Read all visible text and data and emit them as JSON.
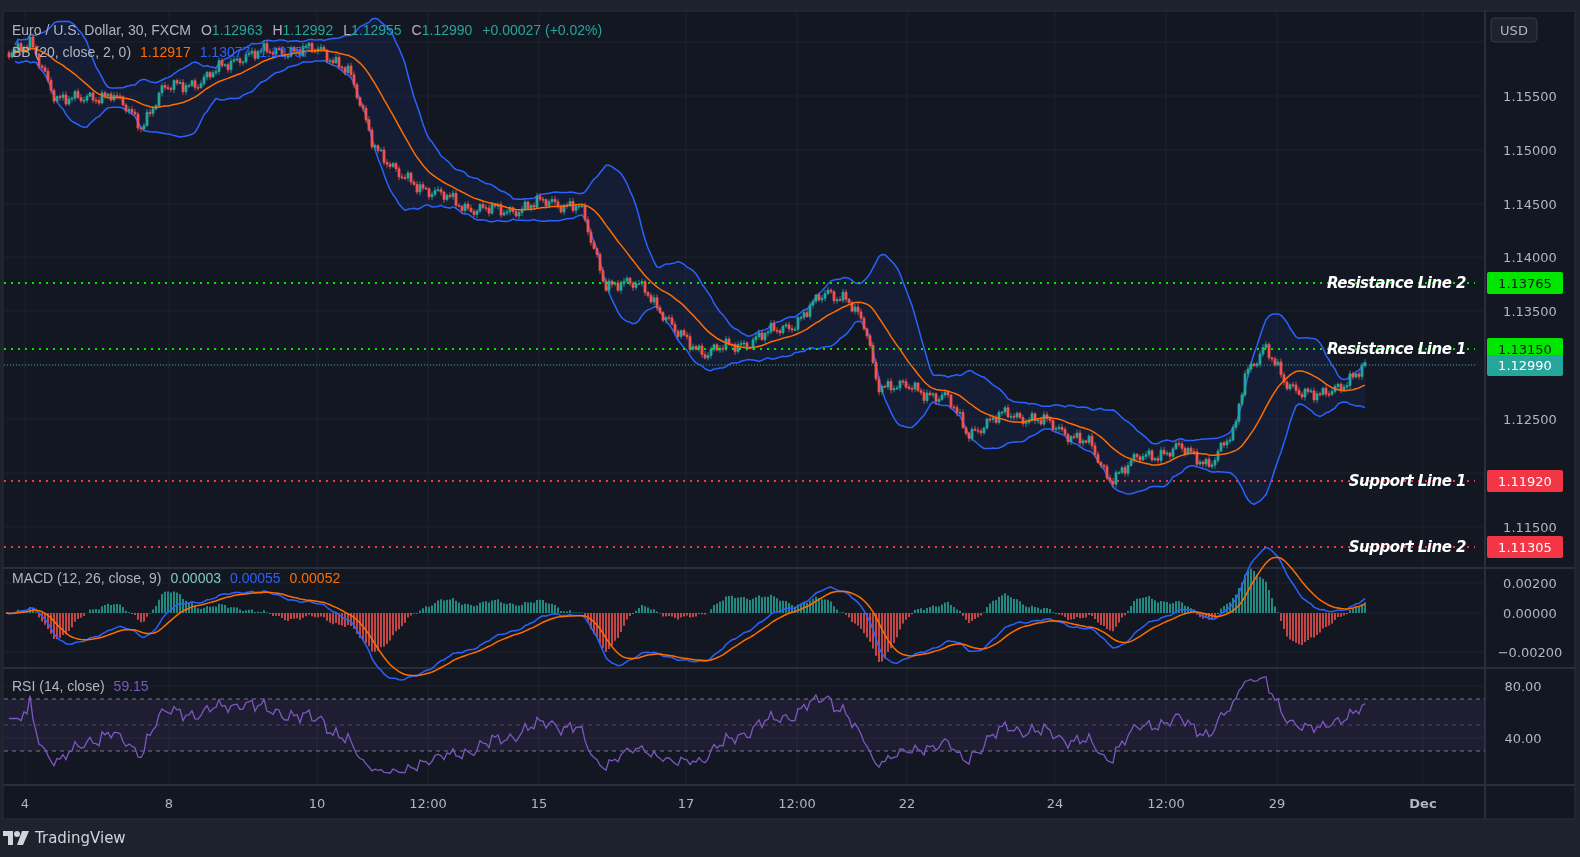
{
  "legend": {
    "symbol": "Euro / U.S. Dollar, 30, FXCM",
    "ohlc": [
      {
        "label": "O",
        "value": "1.12963"
      },
      {
        "label": "H",
        "value": "1.12992"
      },
      {
        "label": "L",
        "value": "1.12955"
      },
      {
        "label": "C",
        "value": "1.12990"
      }
    ],
    "change": "+0.00027 (+0.02%)"
  },
  "bb": {
    "label": "BB (20, close, 2, 0)",
    "values": [
      {
        "text": "1.12917",
        "color": "#ff6d00"
      },
      {
        "text": "1.13077",
        "color": "#2962ff"
      },
      {
        "text": "1.12757",
        "color": "#2962ff"
      }
    ]
  },
  "price_axis": {
    "currency": "USD",
    "ticks": [
      "1.15500",
      "1.15000",
      "1.14500",
      "1.14000",
      "1.13500",
      "1.12500",
      "1.11500"
    ]
  },
  "levels": [
    {
      "label": "Resistance Line 2",
      "price": "1.13765",
      "kind": "resistance"
    },
    {
      "label": "Resistance Line 1",
      "price": "1.13150",
      "kind": "resistance"
    },
    {
      "label": "Support Line 1",
      "price": "1.11920",
      "kind": "support"
    },
    {
      "label": "Support Line 2",
      "price": "1.11305",
      "kind": "support"
    }
  ],
  "last_price": "1.12990",
  "macd": {
    "label": "MACD (12, 26, close, 9)",
    "values": [
      {
        "text": "0.00003",
        "color": "#80cbc4"
      },
      {
        "text": "0.00055",
        "color": "#2962ff"
      },
      {
        "text": "0.00052",
        "color": "#ff6d00"
      }
    ],
    "ticks": [
      "0.00200",
      "0.00000",
      "−0.00200"
    ]
  },
  "rsi": {
    "label": "RSI (14, close)",
    "value": "59.15",
    "ticks": [
      "80.00",
      "40.00"
    ]
  },
  "time_axis": [
    {
      "label": "4",
      "kind": "day"
    },
    {
      "label": "8",
      "kind": "day"
    },
    {
      "label": "10",
      "kind": "day"
    },
    {
      "label": "12:00",
      "kind": "time"
    },
    {
      "label": "15",
      "kind": "day"
    },
    {
      "label": "17",
      "kind": "day"
    },
    {
      "label": "12:00",
      "kind": "time"
    },
    {
      "label": "22",
      "kind": "day"
    },
    {
      "label": "24",
      "kind": "day"
    },
    {
      "label": "12:00",
      "kind": "time"
    },
    {
      "label": "29",
      "kind": "day"
    },
    {
      "label": "Dec",
      "kind": "month"
    }
  ],
  "footer": {
    "brand": "TradingView"
  }
}
